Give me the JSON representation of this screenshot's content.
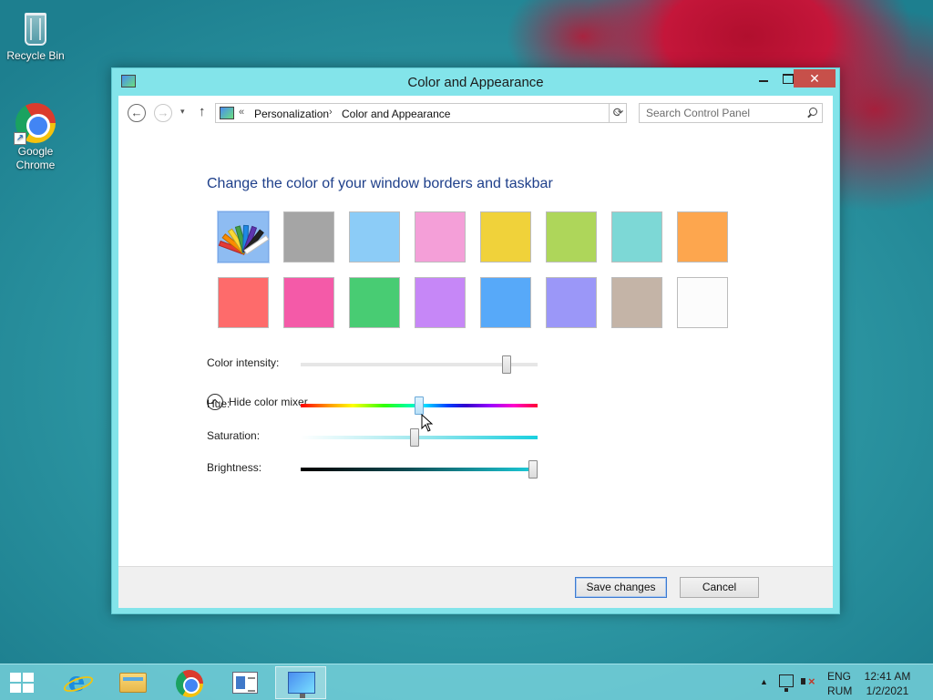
{
  "desktop": {
    "icons": [
      {
        "label": "Recycle Bin",
        "icon": "recycle-bin-icon"
      },
      {
        "label": "Google Chrome",
        "icon": "chrome-icon"
      }
    ]
  },
  "window": {
    "title": "Color and Appearance",
    "controls": {
      "minimize": "minimize-icon",
      "maximize": "maximize-icon",
      "close": "✕"
    }
  },
  "navigation": {
    "back": "←",
    "forward": "→",
    "recent_dropdown": "▾",
    "up": "↑",
    "breadcrumb_chevron": "«",
    "breadcrumbs": [
      "Personalization",
      "Color and Appearance"
    ],
    "breadcrumb_separator": "›",
    "address_dropdown": "⌵",
    "refresh": "⟳",
    "search_placeholder": "Search Control Panel"
  },
  "content": {
    "heading": "Change the color of your window borders and taskbar",
    "swatches": [
      {
        "name": "automatic",
        "color": "#8ebcf2",
        "selected": true
      },
      {
        "name": "gray",
        "color": "#a5a5a5"
      },
      {
        "name": "sky",
        "color": "#8cccf7"
      },
      {
        "name": "pink",
        "color": "#f49fd8"
      },
      {
        "name": "yellow",
        "color": "#f0d23a"
      },
      {
        "name": "lime",
        "color": "#aed65a"
      },
      {
        "name": "teal",
        "color": "#7dd8d6"
      },
      {
        "name": "orange",
        "color": "#fda64e"
      },
      {
        "name": "red",
        "color": "#fe6b6b"
      },
      {
        "name": "magenta",
        "color": "#f45aa8"
      },
      {
        "name": "green",
        "color": "#48cc73"
      },
      {
        "name": "violet",
        "color": "#c687f7"
      },
      {
        "name": "blue",
        "color": "#57a9f9"
      },
      {
        "name": "periwinkle",
        "color": "#9b97f8"
      },
      {
        "name": "taupe",
        "color": "#c4b4a7"
      },
      {
        "name": "white",
        "color": "#fcfcfc"
      }
    ],
    "intensity": {
      "label": "Color intensity:",
      "value": 0.87
    },
    "mixer_toggle": "Hide color mixer",
    "hue": {
      "label": "Hue:",
      "value": 0.5
    },
    "saturation": {
      "label": "Saturation:",
      "value": 0.48
    },
    "brightness": {
      "label": "Brightness:",
      "value": 0.98
    }
  },
  "footer": {
    "save": "Save changes",
    "cancel": "Cancel"
  },
  "taskbar": {
    "apps": [
      "internet-explorer-icon",
      "file-explorer-icon",
      "chrome-icon",
      "document-viewer-icon",
      "control-panel-icon"
    ],
    "active_app": "control-panel-icon",
    "tray": {
      "overflow": "▲",
      "lang_top": "ENG",
      "lang_bottom": "RUM",
      "time": "12:41 AM",
      "date": "1/2/2021"
    }
  }
}
